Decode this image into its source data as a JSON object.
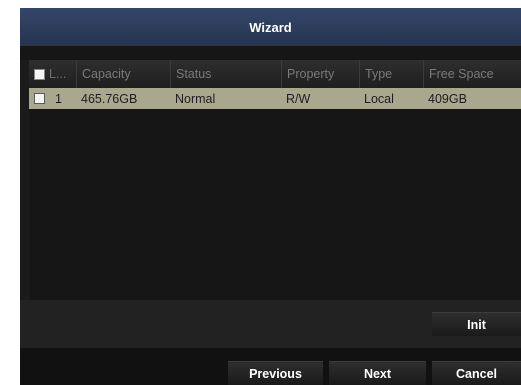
{
  "dialog": {
    "title": "Wizard"
  },
  "table": {
    "columns": [
      "L...",
      "Capacity",
      "Status",
      "Property",
      "Type",
      "Free Space"
    ],
    "rows": [
      {
        "label": "1",
        "capacity": "465.76GB",
        "status": "Normal",
        "property": "R/W",
        "type": "Local",
        "free_space": "409GB",
        "selected": true
      }
    ]
  },
  "buttons": {
    "init": "Init",
    "previous": "Previous",
    "next": "Next",
    "cancel": "Cancel"
  }
}
